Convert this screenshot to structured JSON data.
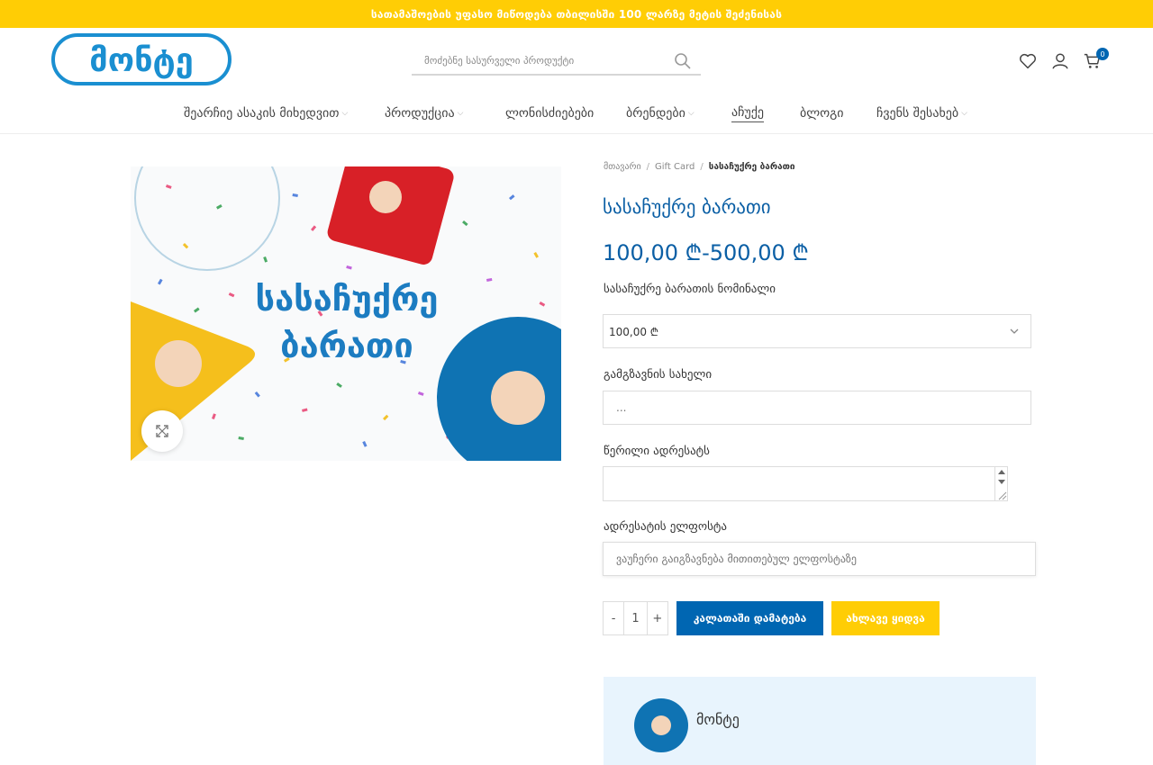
{
  "announcement": "სათამაშოების უფასო მიწოდება თბილისში 100 ლარზე მეტის შეძენისას",
  "brand": {
    "logo_text": "მონტე",
    "primary": "#0066b2",
    "accent": "#ffcd05"
  },
  "search": {
    "placeholder": "მოძებნე სასურველი პროდუქტი"
  },
  "header_icons": {
    "wishlist": "heart-icon",
    "account": "user-icon",
    "cart": "cart-icon",
    "cart_count": "0"
  },
  "nav": [
    {
      "label": "შეარჩიე ასაკის მიხედვით",
      "has_dropdown": true
    },
    {
      "label": "პროდუქცია",
      "has_dropdown": true
    },
    {
      "label": "ლონისძიებები",
      "has_dropdown": false
    },
    {
      "label": "ბრენდები",
      "has_dropdown": true
    },
    {
      "label": "აჩუქე",
      "has_dropdown": false,
      "active": true
    },
    {
      "label": "ბლოგი",
      "has_dropdown": false
    },
    {
      "label": "ჩვენს შესახებ",
      "has_dropdown": true
    }
  ],
  "product_image": {
    "text_line1": "სასაჩუქრე",
    "text_line2": "ბარათი"
  },
  "breadcrumb": {
    "home": "მთავარი",
    "category": "Gift Card",
    "current": "სასაჩუქრე ბარათი"
  },
  "product": {
    "title": "სასაჩუქრე ბარათი",
    "price": "100,00 ₾-500,00 ₾"
  },
  "form": {
    "denomination_label": "სასაჩუქრე ბარათის ნომინალი",
    "denomination_value": "100,00 ₾",
    "sender_label": "გამგზავნის სახელი",
    "sender_placeholder": "...",
    "message_label": "წერილი ადრესატს",
    "email_label": "ადრესატის ელფოსტა",
    "email_placeholder": "ვაუჩერი გაიგზავნება მითითებულ ელფოსტაზე"
  },
  "purchase": {
    "qty_minus": "-",
    "qty_value": "1",
    "qty_plus": "+",
    "add_to_cart": "კალათაში დამატება",
    "buy_now": "ახლავე ყიდვა"
  },
  "vendor": {
    "name": "მონტე"
  }
}
